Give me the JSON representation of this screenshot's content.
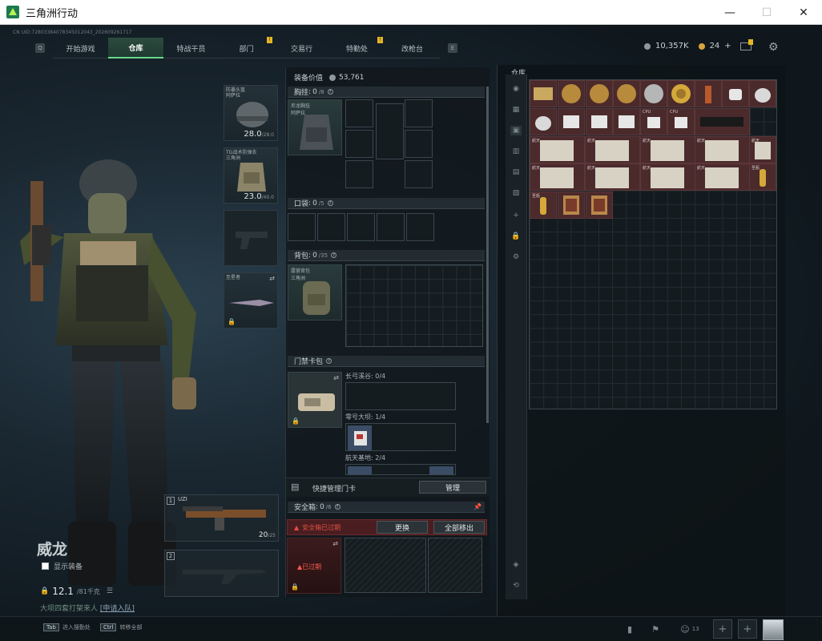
{
  "window": {
    "title": "三角洲行动",
    "minimize": "—",
    "maximize": "☐",
    "close": "✕"
  },
  "uid": "CN UID:7280338407834501​2043_202609261717",
  "nav": {
    "left_key": "Q",
    "right_key": "E",
    "tabs": [
      {
        "label": "开始游戏",
        "notif": ""
      },
      {
        "label": "仓库",
        "notif": ""
      },
      {
        "label": "特战干员",
        "notif": ""
      },
      {
        "label": "部门",
        "notif": "!"
      },
      {
        "label": "交易行",
        "notif": ""
      },
      {
        "label": "特勤处",
        "notif": "!"
      },
      {
        "label": "改枪台",
        "notif": ""
      }
    ],
    "active_index": 1
  },
  "currency": {
    "silver": "10,357K",
    "gold": "24",
    "plus": "+"
  },
  "operator": {
    "name": "威龙",
    "show_equipment": "显示装备",
    "weight": "12.1",
    "weight_max": "/81千克"
  },
  "ticker": {
    "text": "大坝四套打架来人",
    "link": "[申请入队]"
  },
  "gear": {
    "helmet": {
      "label": "防暴头盔 阿萨拉",
      "value": "28.0",
      "max": "/28.0"
    },
    "armor": {
      "label": "TG战术防弹衣 三角洲",
      "value": "23.0",
      "max": "/40.0"
    },
    "melee": {
      "label": "至星者"
    }
  },
  "weapons": {
    "primary": {
      "num": "1",
      "name": "UZI",
      "ammo": "20",
      "ammo_max": "/25"
    },
    "secondary": {
      "num": "2"
    }
  },
  "equipment": {
    "value_label": "装备价值",
    "value": "53,761",
    "chest_rig": {
      "title": "胸挂",
      "count": "0",
      "cap": "/8",
      "item": "尼龙胸挂 阿萨拉"
    },
    "pocket": {
      "title": "口袋",
      "count": "0",
      "cap": "/5"
    },
    "backpack": {
      "title": "背包",
      "count": "0",
      "cap": "/35",
      "item": "露营背包 三角洲"
    },
    "keycard": {
      "title": "门禁卡包",
      "rows": [
        {
          "label": "长弓溪谷: 0/4"
        },
        {
          "label": "零号大坝: 1/4"
        },
        {
          "label": "航天基地: 2/4"
        }
      ]
    },
    "quick_manage": {
      "label": "快捷管理门卡",
      "button": "管理"
    },
    "safebox": {
      "title": "安全箱",
      "count": "0",
      "cap": "/6",
      "expired_warning": "安全箱已过期",
      "replace": "更换",
      "remove_all": "全部移出",
      "expired_tag": "已过期"
    }
  },
  "warehouse": {
    "title": "仓库",
    "items_row1": [
      "",
      "",
      "",
      "",
      "",
      "",
      "",
      "",
      ""
    ],
    "labels": {
      "cpu1": "CPU",
      "cpu2": "CPU",
      "map": "航天",
      "sanctum": "圣瓶"
    }
  },
  "bottom": {
    "hints": [
      {
        "key": "Tab",
        "text": "进入搜勤处"
      },
      {
        "key": "Ctrl",
        "text": "转移全部"
      }
    ],
    "friends": "13"
  }
}
